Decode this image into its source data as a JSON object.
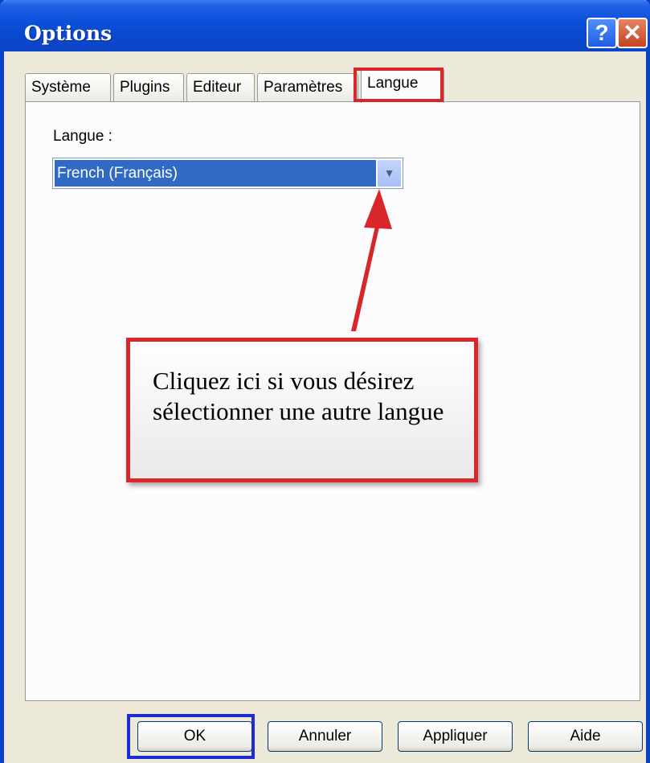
{
  "window": {
    "title": "Options"
  },
  "title_buttons": {
    "help": "?",
    "close": "✕"
  },
  "tabs": [
    {
      "label": "Système"
    },
    {
      "label": "Plugins"
    },
    {
      "label": "Editeur"
    },
    {
      "label": "Paramètres"
    },
    {
      "label": "Langue",
      "active": true
    }
  ],
  "language": {
    "label": "Langue :",
    "selected": "French (Français)"
  },
  "callout": {
    "text": "Cliquez ici si vous désirez sélectionner une autre langue"
  },
  "buttons": {
    "ok": "OK",
    "cancel": "Annuler",
    "apply": "Appliquer",
    "help": "Aide"
  },
  "colors": {
    "annotation_red": "#d8262b",
    "annotation_blue": "#1e2bd0",
    "selection_blue": "#316ac5"
  }
}
